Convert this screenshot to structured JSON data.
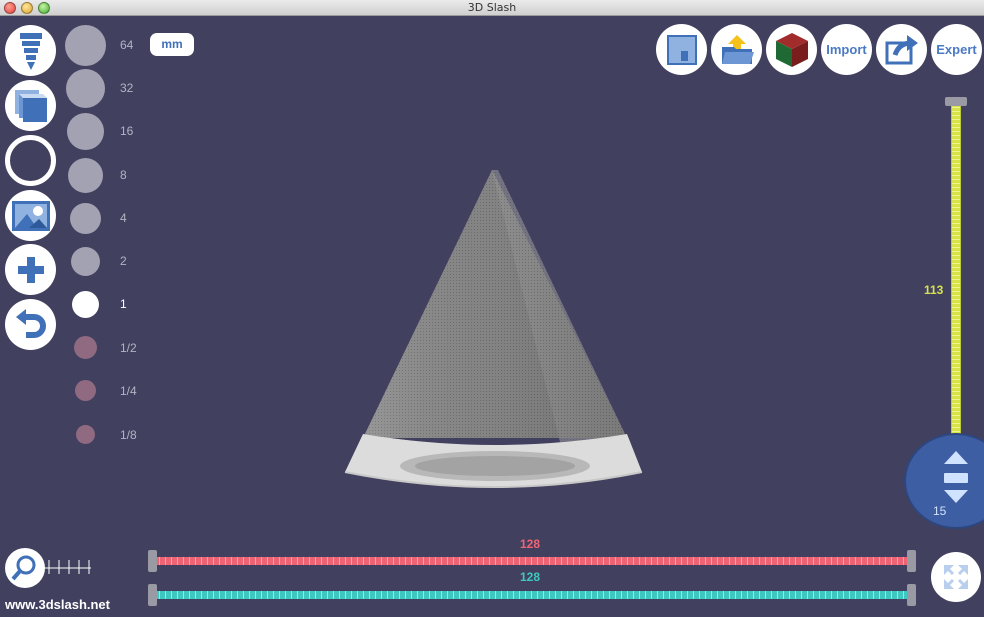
{
  "window": {
    "title": "3D Slash"
  },
  "left_tools": [
    {
      "name": "drill-tool",
      "icon": "drill-icon"
    },
    {
      "name": "cube-tool",
      "icon": "cube-stack-icon"
    },
    {
      "name": "circle-tool",
      "icon": "ring-icon"
    },
    {
      "name": "picture-tool",
      "icon": "image-icon"
    },
    {
      "name": "add-tool",
      "icon": "plus-icon"
    },
    {
      "name": "undo-tool",
      "icon": "undo-icon"
    }
  ],
  "brush_sizes": {
    "active": "1",
    "items": [
      {
        "label": "64"
      },
      {
        "label": "32"
      },
      {
        "label": "16"
      },
      {
        "label": "8"
      },
      {
        "label": "4"
      },
      {
        "label": "2"
      },
      {
        "label": "1"
      },
      {
        "label": "1/2"
      },
      {
        "label": "1/4"
      },
      {
        "label": "1/8"
      }
    ]
  },
  "unit": {
    "label": "mm"
  },
  "top_right": {
    "save_icon": "floppy-disk-icon",
    "open_icon": "open-folder-icon",
    "color_icon": "color-cube-icon",
    "import_label": "Import",
    "share_icon": "share-export-icon",
    "expert_label": "Expert"
  },
  "vertical_slider": {
    "value": "113",
    "knob_value": "15",
    "color": "#d6e34b"
  },
  "horizontal_sliders": {
    "red": {
      "value": "128",
      "color": "#ef6475"
    },
    "teal": {
      "value": "128",
      "color": "#3ec8c1"
    }
  },
  "footer": {
    "site": "www.3dslash.net"
  },
  "colors": {
    "background": "#42405f",
    "accent": "#3f70b8"
  }
}
